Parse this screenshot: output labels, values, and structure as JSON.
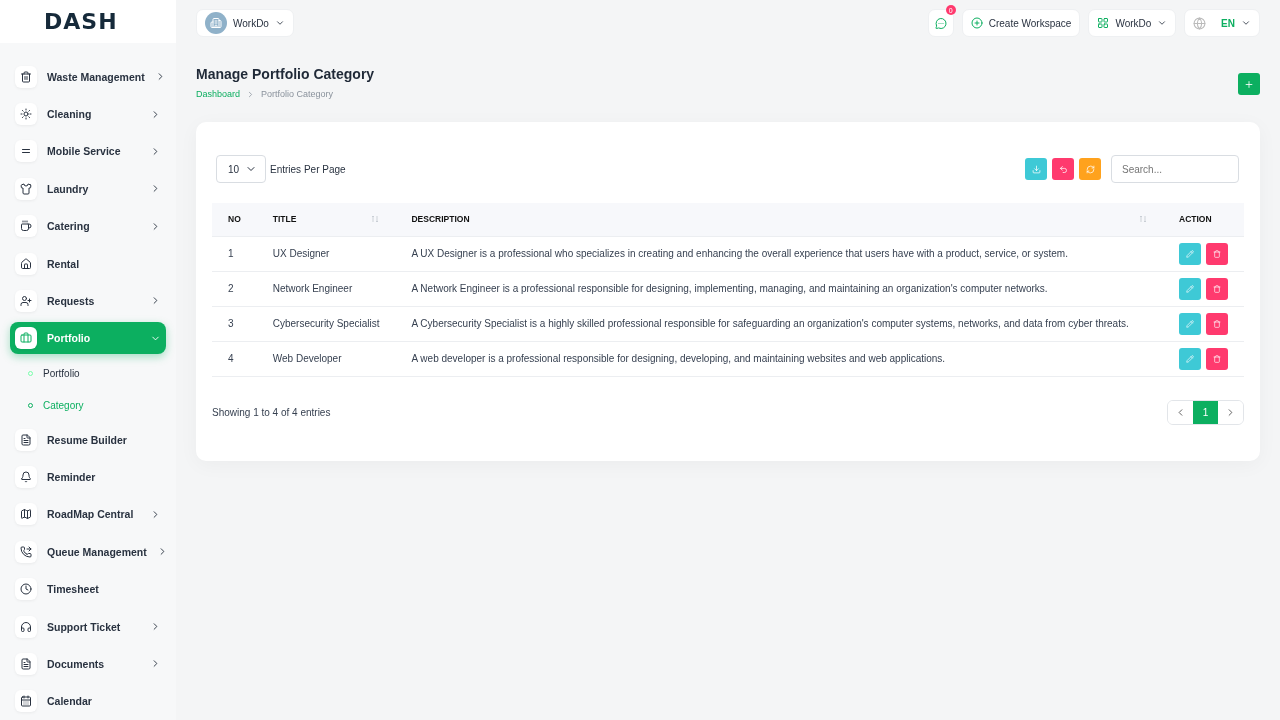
{
  "logo": "DASH",
  "header": {
    "workspace": "WorkDo",
    "notifications": "0",
    "create_workspace": "Create Workspace",
    "app_switcher": "WorkDo",
    "language": "EN"
  },
  "sidebar": {
    "items": [
      {
        "label": "Waste Management",
        "kind": "submenu",
        "selected": false,
        "expanded": false
      },
      {
        "label": "Cleaning",
        "kind": "submenu",
        "selected": false,
        "expanded": false
      },
      {
        "label": "Mobile Service",
        "kind": "submenu",
        "selected": false,
        "expanded": false
      },
      {
        "label": "Laundry",
        "kind": "submenu",
        "selected": false,
        "expanded": false
      },
      {
        "label": "Catering",
        "kind": "submenu",
        "selected": false,
        "expanded": false
      },
      {
        "label": "Rental",
        "kind": "link",
        "selected": false
      },
      {
        "label": "Requests",
        "kind": "submenu",
        "selected": false,
        "expanded": false
      },
      {
        "label": "Portfolio",
        "kind": "submenu",
        "selected": true,
        "expanded": true,
        "children": [
          {
            "label": "Portfolio",
            "selected": false
          },
          {
            "label": "Category",
            "selected": true
          }
        ]
      },
      {
        "label": "Resume Builder",
        "kind": "link",
        "selected": false
      },
      {
        "label": "Reminder",
        "kind": "link",
        "selected": false
      },
      {
        "label": "RoadMap Central",
        "kind": "submenu",
        "selected": false,
        "expanded": false
      },
      {
        "label": "Queue Management",
        "kind": "submenu",
        "selected": false,
        "expanded": false
      },
      {
        "label": "Timesheet",
        "kind": "link",
        "selected": false
      },
      {
        "label": "Support Ticket",
        "kind": "submenu",
        "selected": false,
        "expanded": false
      },
      {
        "label": "Documents",
        "kind": "submenu",
        "selected": false,
        "expanded": false
      },
      {
        "label": "Calendar",
        "kind": "link",
        "selected": false
      }
    ]
  },
  "page": {
    "title": "Manage Portfolio Category",
    "breadcrumb": [
      "Dashboard",
      "Portfolio Category"
    ]
  },
  "table_controls": {
    "entries_value": "10",
    "entries_label": "Entries Per Page",
    "search_placeholder": "Search..."
  },
  "table": {
    "columns": [
      {
        "label": "NO",
        "sortable": false
      },
      {
        "label": "TITLE",
        "sortable": true
      },
      {
        "label": "DESCRIPTION",
        "sortable": true
      },
      {
        "label": "ACTION",
        "sortable": false
      }
    ],
    "rows": [
      {
        "no": "1",
        "title": "UX Designer",
        "description": "A UX Designer is a professional who specializes in creating and enhancing the overall experience that users have with a product, service, or system."
      },
      {
        "no": "2",
        "title": "Network Engineer",
        "description": "A Network Engineer is a professional responsible for designing, implementing, managing, and maintaining an organization's computer networks."
      },
      {
        "no": "3",
        "title": "Cybersecurity Specialist",
        "description": "A Cybersecurity Specialist is a highly skilled professional responsible for safeguarding an organization's computer systems, networks, and data from cyber threats."
      },
      {
        "no": "4",
        "title": "Web Developer",
        "description": "A web developer is a professional responsible for designing, developing, and maintaining websites and web applications."
      }
    ]
  },
  "footer": {
    "summary": "Showing 1 to 4 of 4 entries",
    "pages": [
      {
        "label": "1",
        "selected": true
      }
    ]
  }
}
